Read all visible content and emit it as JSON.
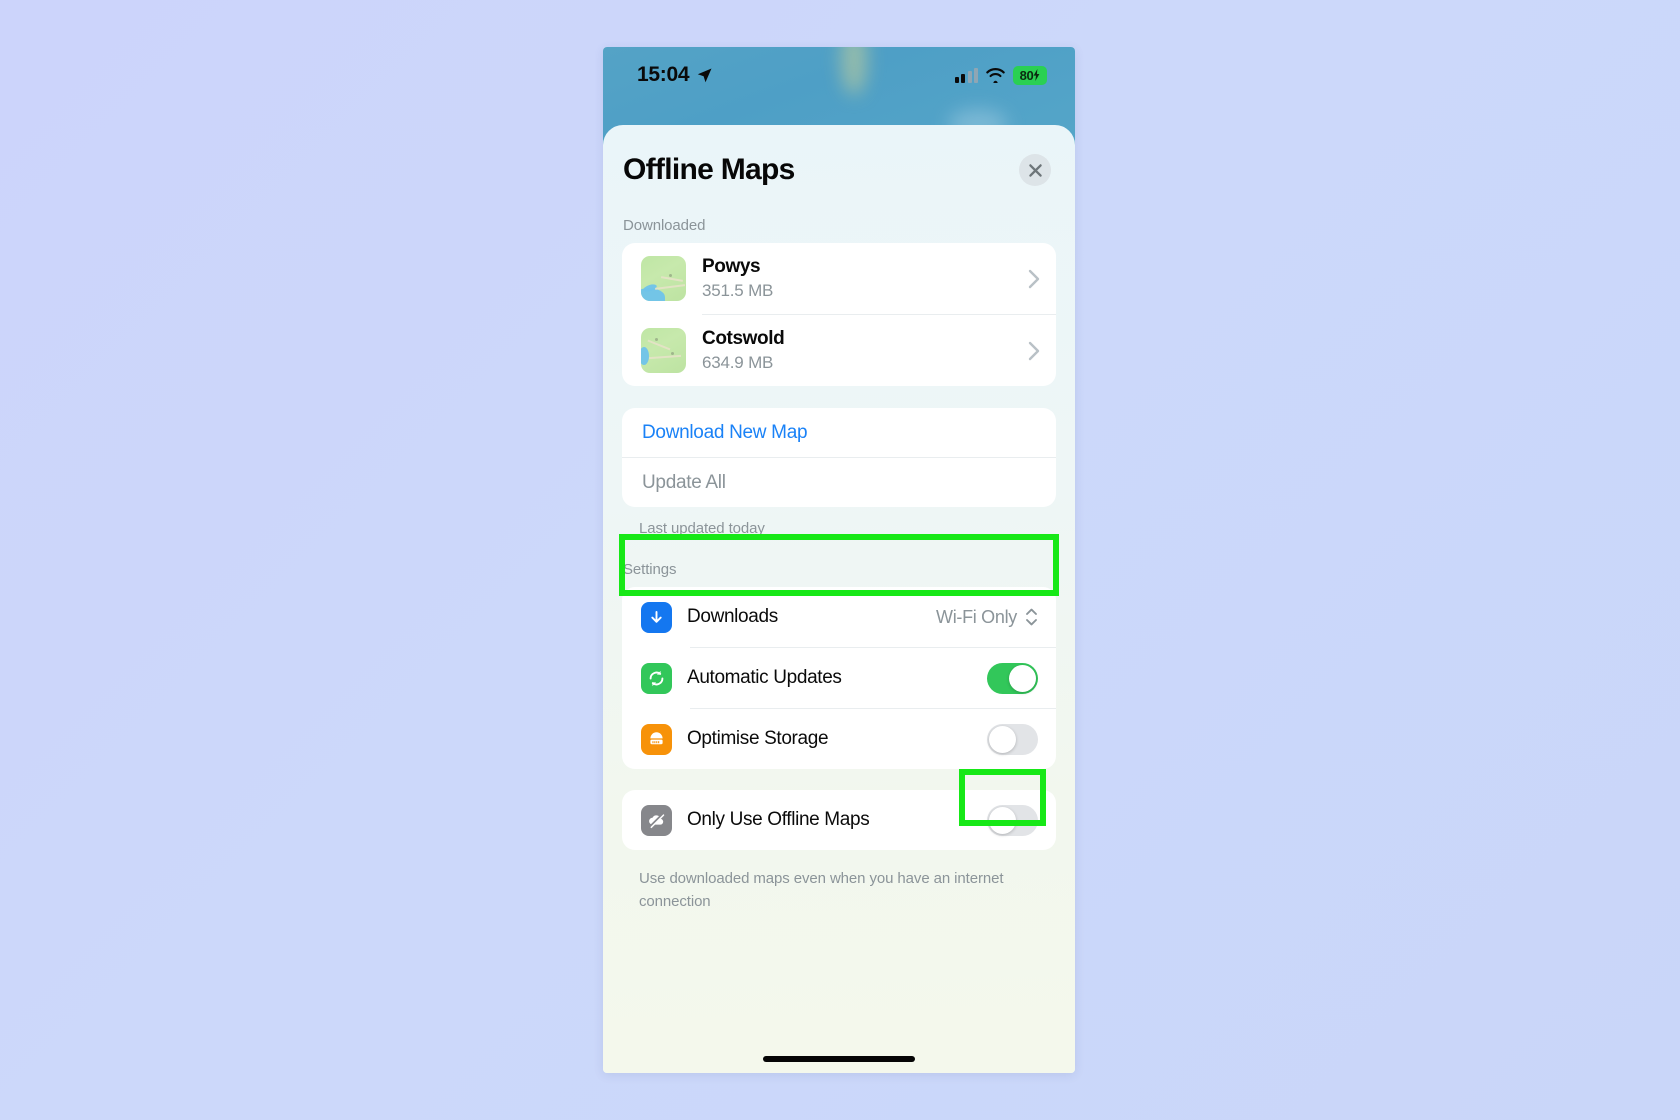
{
  "status_bar": {
    "time": "15:04",
    "location_icon": "location-arrow-icon",
    "cellular_icon": "cellular-bars-icon",
    "wifi_icon": "wifi-icon",
    "battery_percent": "80",
    "battery_charging_icon": "lightning-bolt-icon"
  },
  "sheet": {
    "title": "Offline Maps",
    "close_icon": "close-x-icon"
  },
  "downloaded": {
    "section_label": "Downloaded",
    "items": [
      {
        "name": "Powys",
        "size": "351.5 MB",
        "thumbnail": "map-thumbnail",
        "chevron": "chevron-right-icon"
      },
      {
        "name": "Cotswold",
        "size": "634.9 MB",
        "thumbnail": "map-thumbnail",
        "chevron": "chevron-right-icon"
      }
    ]
  },
  "actions": {
    "download_new_map": "Download New Map",
    "update_all": "Update All",
    "last_updated": "Last updated today"
  },
  "settings": {
    "section_label": "Settings",
    "rows": [
      {
        "label": "Downloads",
        "value": "Wi-Fi Only",
        "icon": "download-arrow-icon",
        "icon_color": "#1477f0",
        "control": "stepper"
      },
      {
        "label": "Automatic Updates",
        "icon": "refresh-circular-icon",
        "icon_color": "#32c75a",
        "control": "toggle",
        "state": "on"
      },
      {
        "label": "Optimise Storage",
        "icon": "storage-drive-icon",
        "icon_color": "#f79209",
        "control": "toggle",
        "state": "off"
      }
    ],
    "offline_only": {
      "label": "Only Use Offline Maps",
      "icon": "cloud-slash-icon",
      "icon_color": "#86878b",
      "control": "toggle",
      "state": "off"
    },
    "footnote": "Use downloaded maps even when you have an internet connection"
  },
  "colors": {
    "accent_blue": "#1a82f7",
    "toggle_on_green": "#32c75a",
    "highlight_green": "#17e817",
    "page_background": "#ccd6fa"
  }
}
